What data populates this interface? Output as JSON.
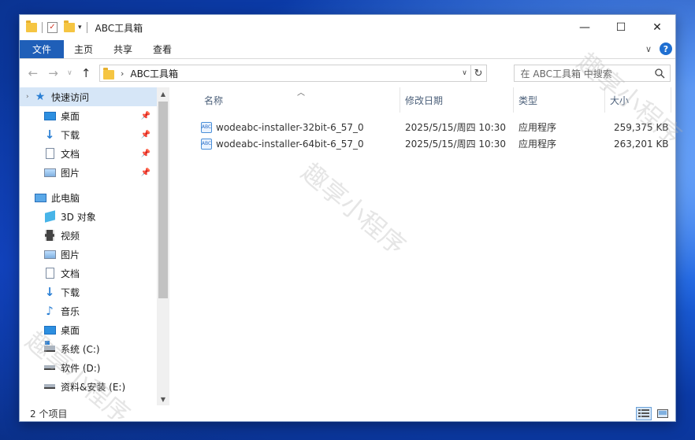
{
  "window": {
    "title": "ABC工具箱",
    "minimize_glyph": "—",
    "maximize_glyph": "☐",
    "close_glyph": "✕"
  },
  "ribbon": {
    "tabs": [
      "文件",
      "主页",
      "共享",
      "查看"
    ],
    "help_glyph": "?",
    "expand_glyph": "∨"
  },
  "address": {
    "path": "ABC工具箱",
    "separator": "›",
    "search_placeholder": "在 ABC工具箱 中搜索"
  },
  "nav": {
    "quick_access": {
      "label": "快速访问",
      "items": [
        {
          "label": "桌面",
          "icon": "desktop-icon",
          "pinned": true
        },
        {
          "label": "下载",
          "icon": "download-icon",
          "pinned": true
        },
        {
          "label": "文档",
          "icon": "document-icon",
          "pinned": true
        },
        {
          "label": "图片",
          "icon": "picture-icon",
          "pinned": true
        }
      ]
    },
    "this_pc": {
      "label": "此电脑",
      "items": [
        {
          "label": "3D 对象",
          "icon": "3d-objects-icon"
        },
        {
          "label": "视频",
          "icon": "video-icon"
        },
        {
          "label": "图片",
          "icon": "picture-icon"
        },
        {
          "label": "文档",
          "icon": "document-icon"
        },
        {
          "label": "下载",
          "icon": "download-icon"
        },
        {
          "label": "音乐",
          "icon": "music-icon"
        },
        {
          "label": "桌面",
          "icon": "desktop-icon"
        },
        {
          "label": "系统 (C:)",
          "icon": "system-drive-icon"
        },
        {
          "label": "软件 (D:)",
          "icon": "drive-icon"
        },
        {
          "label": "资料&安装 (E:)",
          "icon": "drive-icon"
        }
      ]
    }
  },
  "columns": {
    "name": "名称",
    "modified": "修改日期",
    "type": "类型",
    "size": "大小"
  },
  "files": [
    {
      "name": "wodeabc-installer-32bit-6_57_0",
      "modified": "2025/5/15/周四 10:30",
      "type": "应用程序",
      "size": "259,375 KB"
    },
    {
      "name": "wodeabc-installer-64bit-6_57_0",
      "modified": "2025/5/15/周四 10:30",
      "type": "应用程序",
      "size": "263,201 KB"
    }
  ],
  "status": {
    "item_count": "2 个项目"
  },
  "watermark": "趣享小程序"
}
